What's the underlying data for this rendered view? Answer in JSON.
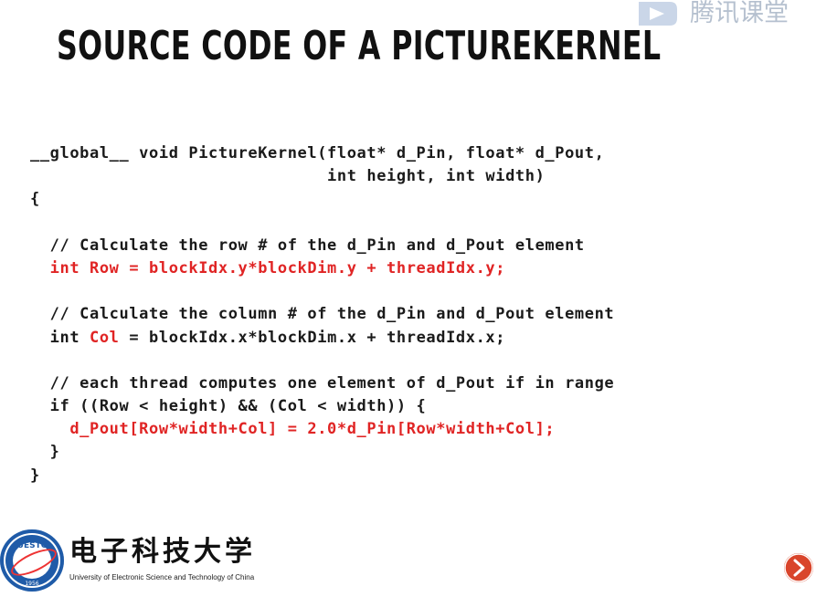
{
  "slide": {
    "title": "SOURCE CODE OF A PICTUREKERNEL"
  },
  "watermark": {
    "text": "腾讯课堂",
    "icon": "play-icon"
  },
  "code": {
    "lines": [
      {
        "segments": [
          {
            "text": "__global__ void PictureKernel(float* d_Pin, float* d_Pout,",
            "red": false
          }
        ]
      },
      {
        "segments": [
          {
            "text": "                              int height, int width)",
            "red": false
          }
        ]
      },
      {
        "segments": [
          {
            "text": "{",
            "red": false
          }
        ]
      },
      {
        "segments": [
          {
            "text": "",
            "red": false
          }
        ]
      },
      {
        "segments": [
          {
            "text": "  // Calculate the row # of the d_Pin and d_Pout element",
            "red": false
          }
        ]
      },
      {
        "segments": [
          {
            "text": "  int Row = blockIdx.y*blockDim.y + threadIdx.y;",
            "red": true
          }
        ]
      },
      {
        "segments": [
          {
            "text": "",
            "red": false
          }
        ]
      },
      {
        "segments": [
          {
            "text": "  // Calculate the column # of the d_Pin and d_Pout element",
            "red": false
          }
        ]
      },
      {
        "segments": [
          {
            "text": "  int ",
            "red": false
          },
          {
            "text": "Col",
            "red": true
          },
          {
            "text": " = blockIdx.x*blockDim.x + threadIdx.x;",
            "red": false
          }
        ]
      },
      {
        "segments": [
          {
            "text": "",
            "red": false
          }
        ]
      },
      {
        "segments": [
          {
            "text": "  // each thread computes one element of d_Pout if in range",
            "red": false
          }
        ]
      },
      {
        "segments": [
          {
            "text": "  if ((Row < height) && (Col < width)) {",
            "red": false
          }
        ]
      },
      {
        "segments": [
          {
            "text": "    d_Pout[Row*width+Col] = 2.0*d_Pin[Row*width+Col];",
            "red": true
          }
        ]
      },
      {
        "segments": [
          {
            "text": "  }",
            "red": false
          }
        ]
      },
      {
        "segments": [
          {
            "text": "}",
            "red": false
          }
        ]
      }
    ]
  },
  "logo": {
    "seal_text": "UESTC",
    "seal_year": "1956",
    "name_cn": "电子科技大学",
    "name_en": "University of Electronic Science and Technology of China"
  },
  "nav": {
    "icon": "next-slide-icon"
  },
  "colors": {
    "code_red": "#e02424",
    "code_text": "#1a1a1a",
    "nav_red": "#d9452b"
  }
}
